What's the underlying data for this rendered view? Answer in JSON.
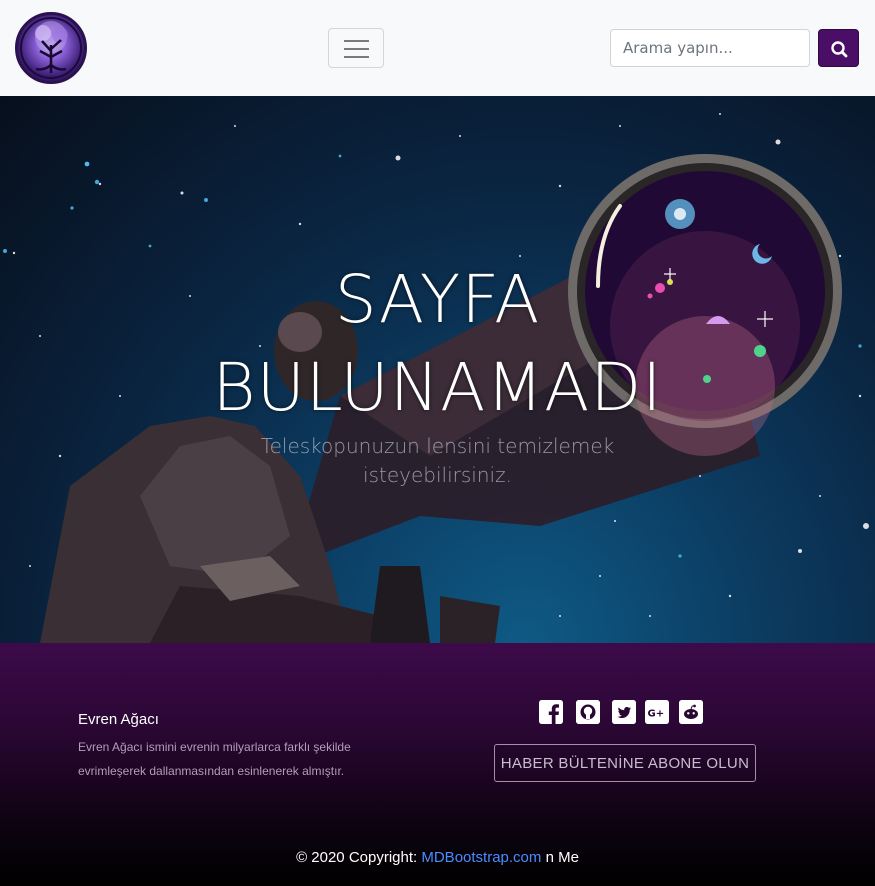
{
  "navbar": {
    "logo_icon": "tree-of-life-logo",
    "toggler_icon": "hamburger-icon",
    "search": {
      "placeholder": "Arama yapın...",
      "value": ""
    },
    "search_button_icon": "search-icon"
  },
  "hero": {
    "title_line1": "SAYFA",
    "title_line2": "BULUNAMADI",
    "subtitle": "Teleskopunuzun lensini temizlemek isteyebilirsiniz."
  },
  "footer": {
    "title": "Evren Ağacı",
    "description": "Evren Ağacı ismini evrenin milyarlarca farklı şekilde evrimleşerek dallanmasından esinlenerek almıştır.",
    "social_icons": [
      "facebook-icon",
      "github-icon",
      "twitter-icon",
      "google-plus-icon",
      "reddit-icon"
    ],
    "subscribe_label": "HABER BÜLTENİNE ABONE OLUN",
    "copyright_prefix": "© 2020 Copyright: ",
    "copyright_link": "MDBootstrap.com",
    "copyright_suffix": " n Me"
  },
  "colors": {
    "brand_purple": "#4a0e66",
    "footer_top": "#3d0a4a",
    "link_blue": "#4a8cff"
  }
}
